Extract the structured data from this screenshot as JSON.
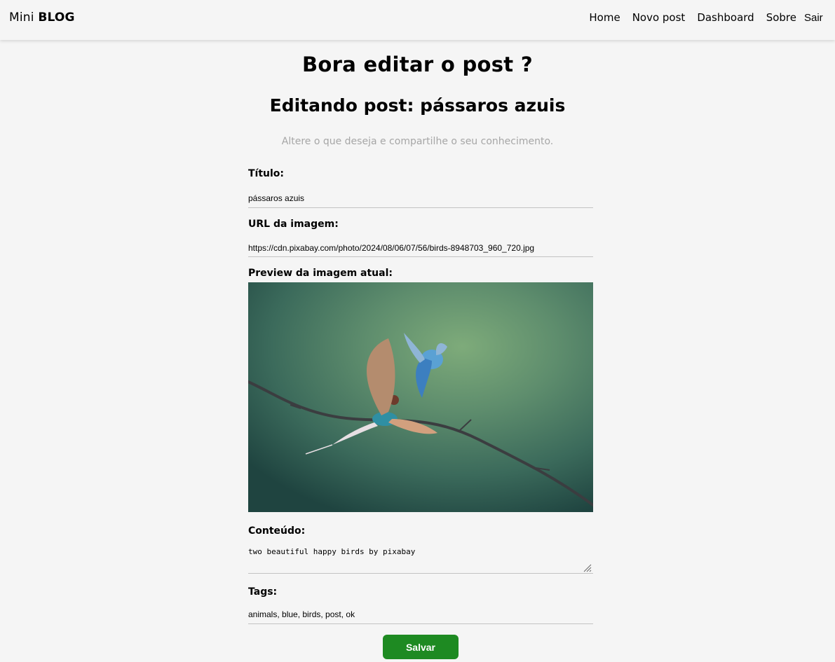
{
  "nav": {
    "brand_light": "Mini",
    "brand_bold": "BLOG",
    "links": [
      "Home",
      "Novo post",
      "Dashboard",
      "Sobre"
    ],
    "logout": "Sair"
  },
  "page": {
    "title": "Bora editar o post ?",
    "subtitle_heading": "Editando post: pássaros azuis",
    "description": "Altere o que deseja e compartilhe o seu conhecimento."
  },
  "form": {
    "title_label": "Título:",
    "title_value": "pássaros azuis",
    "image_label": "URL da imagem:",
    "image_value": "https://cdn.pixabay.com/photo/2024/08/06/07/56/birds-8948703_960_720.jpg",
    "preview_label": "Preview da imagem atual:",
    "content_label": "Conteúdo:",
    "content_value": "two beautiful happy birds by pixabay",
    "tags_label": "Tags:",
    "tags_value": "animals, blue, birds, post, ok",
    "save_label": "Salvar"
  },
  "colors": {
    "background": "#f5f5f5",
    "save_button": "#1e8a22",
    "muted_text": "#a6a6a6"
  }
}
